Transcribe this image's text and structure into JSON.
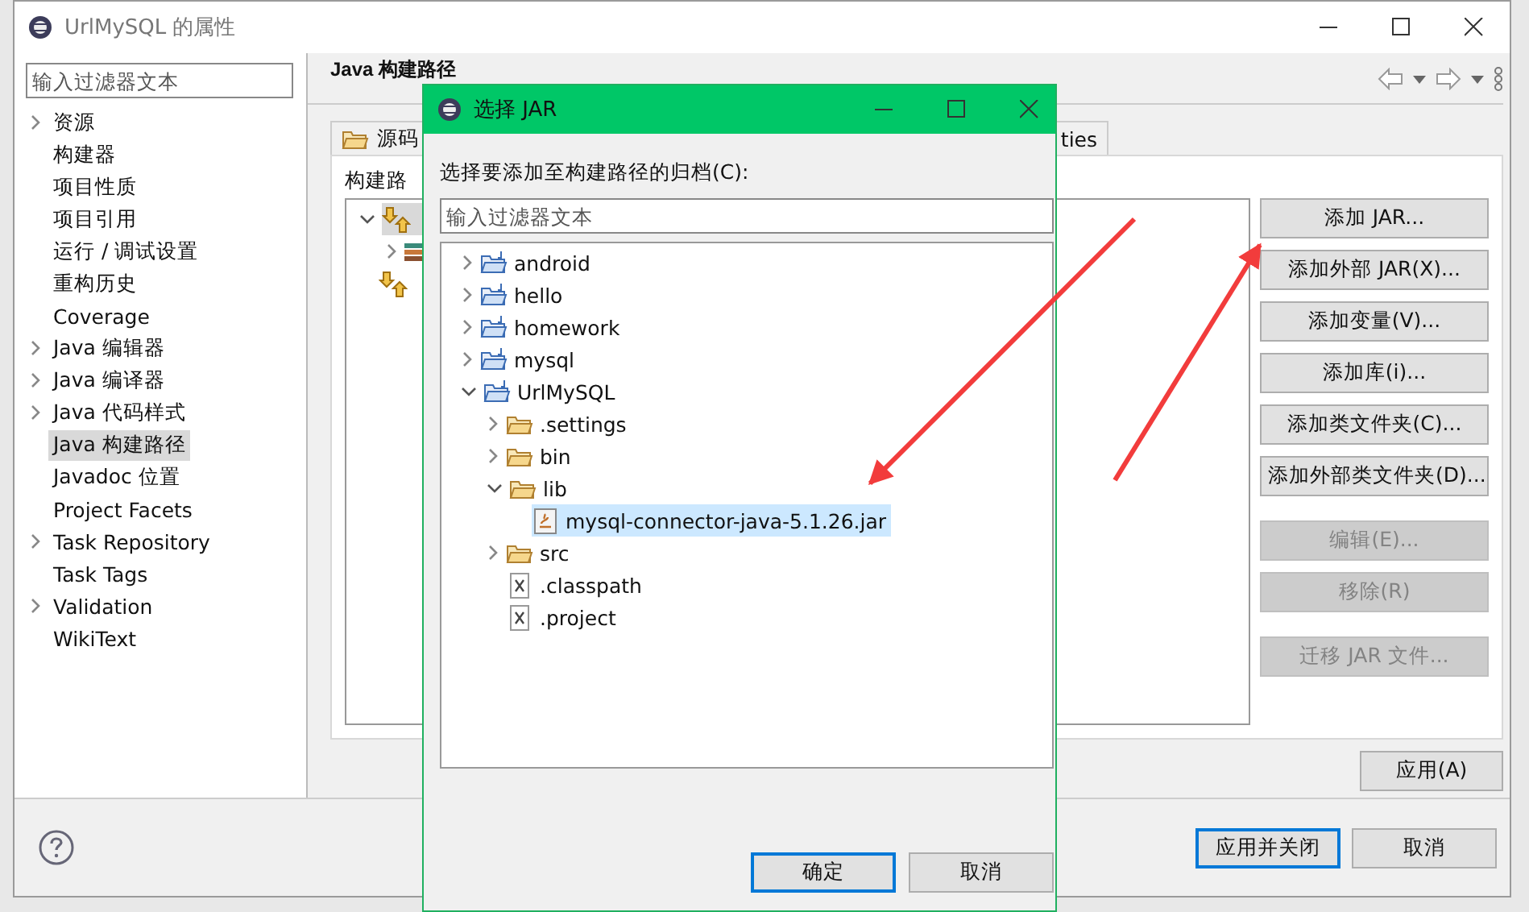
{
  "window": {
    "title": "UrlMySQL 的属性"
  },
  "sidebar": {
    "filter_placeholder": "输入过滤器文本",
    "items": [
      {
        "label": "资源",
        "expandable": true,
        "selected": false
      },
      {
        "label": "构建器",
        "expandable": false,
        "selected": false
      },
      {
        "label": "项目性质",
        "expandable": false,
        "selected": false
      },
      {
        "label": "项目引用",
        "expandable": false,
        "selected": false
      },
      {
        "label": "运行 / 调试设置",
        "expandable": false,
        "selected": false
      },
      {
        "label": "重构历史",
        "expandable": false,
        "selected": false
      },
      {
        "label": "Coverage",
        "expandable": false,
        "selected": false
      },
      {
        "label": "Java 编辑器",
        "expandable": true,
        "selected": false
      },
      {
        "label": "Java 编译器",
        "expandable": true,
        "selected": false
      },
      {
        "label": "Java 代码样式",
        "expandable": true,
        "selected": false
      },
      {
        "label": "Java 构建路径",
        "expandable": false,
        "selected": true
      },
      {
        "label": "Javadoc 位置",
        "expandable": false,
        "selected": false
      },
      {
        "label": "Project Facets",
        "expandable": false,
        "selected": false
      },
      {
        "label": "Task Repository",
        "expandable": true,
        "selected": false
      },
      {
        "label": "Task Tags",
        "expandable": false,
        "selected": false
      },
      {
        "label": "Validation",
        "expandable": true,
        "selected": false
      },
      {
        "label": "WikiText",
        "expandable": false,
        "selected": false
      }
    ]
  },
  "page": {
    "title": "Java 构建路径",
    "tabs": [
      {
        "label": "源码",
        "selected": false
      },
      {
        "label": "ties",
        "selected": false
      }
    ],
    "section_label": "构建路",
    "tree": [
      {
        "kind": "entries",
        "expanded": true,
        "selected": true,
        "children": [
          {
            "kind": "library",
            "expanded": false,
            "selected": false
          }
        ]
      },
      {
        "kind": "entries",
        "selected": false
      }
    ],
    "button_groups": [
      [
        {
          "label": "添加 JAR...",
          "disabled": false
        },
        {
          "label": "添加外部 JAR(X)...",
          "disabled": false
        },
        {
          "label": "添加变量(V)...",
          "disabled": false
        },
        {
          "label": "添加库(i)...",
          "disabled": false
        },
        {
          "label": "添加类文件夹(C)...",
          "disabled": false
        },
        {
          "label": "添加外部类文件夹(D)...",
          "disabled": false
        }
      ],
      [
        {
          "label": "编辑(E)...",
          "disabled": true
        },
        {
          "label": "移除(R)",
          "disabled": true
        }
      ],
      [
        {
          "label": "迁移 JAR 文件...",
          "disabled": true
        }
      ]
    ],
    "apply_button": "应用(A)"
  },
  "footer_buttons": [
    {
      "label": "应用并关闭",
      "default": true
    },
    {
      "label": "取消",
      "default": false
    }
  ],
  "dialog": {
    "title": "选择 JAR",
    "prompt": "选择要添加至构建路径的归档(C):",
    "filter_placeholder": "输入过滤器文本",
    "tree": [
      {
        "label": "android",
        "kind": "project",
        "expanded": false,
        "selected": false
      },
      {
        "label": "hello",
        "kind": "project",
        "expanded": false,
        "selected": false
      },
      {
        "label": "homework",
        "kind": "project",
        "expanded": false,
        "selected": false
      },
      {
        "label": "mysql",
        "kind": "project",
        "expanded": false,
        "selected": false
      },
      {
        "label": "UrlMySQL",
        "kind": "project",
        "expanded": true,
        "selected": false,
        "children": [
          {
            "label": ".settings",
            "kind": "folder",
            "expanded": false,
            "selected": false
          },
          {
            "label": "bin",
            "kind": "folder",
            "expanded": false,
            "selected": false
          },
          {
            "label": "lib",
            "kind": "folder",
            "expanded": true,
            "selected": false,
            "children": [
              {
                "label": "mysql-connector-java-5.1.26.jar",
                "kind": "jar",
                "selected": true
              }
            ]
          },
          {
            "label": "src",
            "kind": "folder",
            "expanded": false,
            "selected": false
          },
          {
            "label": ".classpath",
            "kind": "xml",
            "selected": false
          },
          {
            "label": ".project",
            "kind": "xml",
            "selected": false
          }
        ]
      }
    ],
    "buttons": [
      {
        "label": "确定",
        "default": true
      },
      {
        "label": "取消",
        "default": false
      }
    ]
  }
}
